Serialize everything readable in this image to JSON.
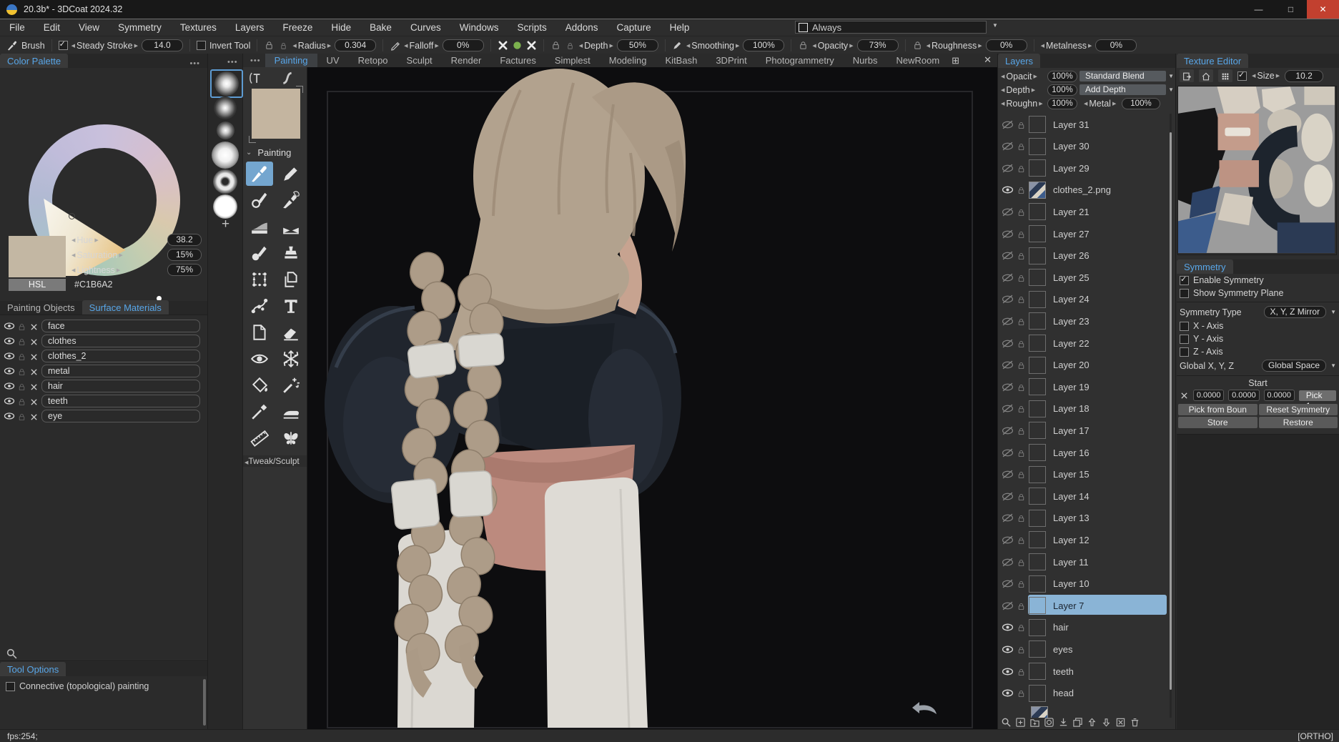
{
  "window": {
    "title": "20.3b* - 3DCoat 2024.32",
    "minimize": "—",
    "maximize": "□",
    "close": "✕"
  },
  "menubar": {
    "items": [
      "File",
      "Edit",
      "View",
      "Symmetry",
      "Textures",
      "Layers",
      "Freeze",
      "Hide",
      "Bake",
      "Curves",
      "Windows",
      "Scripts",
      "Addons",
      "Capture",
      "Help"
    ],
    "always": {
      "label": "Always",
      "checked": false
    }
  },
  "toolbar": {
    "brush": {
      "label": "Brush",
      "icon": "brush-icon"
    },
    "controls": [
      {
        "kind": "checkspin",
        "checked": true,
        "label": "Steady Stroke",
        "value": "14.0"
      },
      {
        "kind": "check",
        "checked": false,
        "label": "Invert Tool"
      },
      {
        "kind": "spin",
        "icons": [
          "lock",
          "lock2"
        ],
        "label": "Radius",
        "value": "0.304"
      },
      {
        "kind": "spin",
        "icons": [
          "pen"
        ],
        "label": "Falloff",
        "value": "0%"
      },
      {
        "kind": "iconset",
        "icons": [
          "xbold",
          "greendot",
          "xbold"
        ]
      },
      {
        "kind": "spin",
        "icons": [
          "lock",
          "lock2"
        ],
        "label": "Depth",
        "value": "50%"
      },
      {
        "kind": "spin",
        "icons": [
          "pencil"
        ],
        "label": "Smoothing",
        "value": "100%"
      },
      {
        "kind": "spin",
        "icons": [
          "lock"
        ],
        "label": "Opacity",
        "value": "73%"
      },
      {
        "kind": "spin",
        "icons": [
          "lock"
        ],
        "label": "Roughness",
        "value": "0%"
      },
      {
        "kind": "spin",
        "icons": [],
        "label": "Metalness",
        "value": "0%"
      }
    ]
  },
  "color_palette": {
    "tab": "Color Palette",
    "menu_icon": "ellipsis-menu",
    "hsl": {
      "hue_label": "Hue",
      "hue": "38.2",
      "sat_label": "Saturation",
      "sat": "15%",
      "light_label": "Lightness",
      "light": "75%",
      "mode": "HSL",
      "hex": "#C1B6A2"
    },
    "swatch": "#C1B6A2"
  },
  "object_tabs": {
    "painting_objects": "Painting Objects",
    "surface_materials": "Surface Materials",
    "active": "Surface Materials"
  },
  "materials": [
    "face",
    "clothes",
    "clothes_2",
    "metal",
    "hair",
    "teeth",
    "eye"
  ],
  "tool_options": {
    "tab": "Tool Options",
    "option": "Connective (topological) painting",
    "checked": false
  },
  "status": {
    "fps": "fps:254;",
    "mode": "[ORTHO]"
  },
  "rooms": {
    "tabs": [
      "Painting",
      "UV",
      "Retopo",
      "Sculpt",
      "Render",
      "Factures",
      "Simplest",
      "Modeling",
      "KitBash",
      "3DPrint",
      "Photogrammetry",
      "Nurbs",
      "NewRoom"
    ],
    "active": "Painting",
    "add_icon": "add-room",
    "close_icon": "close-tabbar"
  },
  "brush_panel": {
    "tips": [
      "soft-round",
      "soft-round-2",
      "small-soft",
      "large-soft",
      "ring",
      "solid"
    ],
    "selected": 0,
    "add": "+",
    "menu_icon": "ellipsis-menu"
  },
  "tool_panel": {
    "header": "Painting",
    "footer": "Tweak/Sculpt",
    "swatch": "#C4B5A0",
    "top_icons": [
      "text-frame",
      "stroke-curve"
    ],
    "tools": [
      {
        "name": "brush",
        "selected": true
      },
      {
        "name": "pencil"
      },
      {
        "name": "dry-brush"
      },
      {
        "name": "smudge"
      },
      {
        "name": "gradient"
      },
      {
        "name": "pinch"
      },
      {
        "name": "airbrush"
      },
      {
        "name": "stamp"
      },
      {
        "name": "lattice"
      },
      {
        "name": "copy"
      },
      {
        "name": "spline"
      },
      {
        "name": "text"
      },
      {
        "name": "image"
      },
      {
        "name": "eraser"
      },
      {
        "name": "eye"
      },
      {
        "name": "freeze"
      },
      {
        "name": "fill"
      },
      {
        "name": "magic-wand"
      },
      {
        "name": "picker"
      },
      {
        "name": "iron"
      },
      {
        "name": "ruler"
      },
      {
        "name": "symmetry-copy"
      }
    ]
  },
  "layers_panel": {
    "tab": "Layers",
    "opacity_label": "Opacit",
    "opacity": "100%",
    "blend": "Standard Blend",
    "depth_label": "Depth",
    "depth": "100%",
    "depth_blend": "Add Depth",
    "rough_label": "Roughn",
    "rough": "100%",
    "metal_label": "Metal",
    "metal": "100%",
    "layers": [
      {
        "name": "Layer 31",
        "visible": false
      },
      {
        "name": "Layer 30",
        "visible": false
      },
      {
        "name": "Layer 29",
        "visible": false
      },
      {
        "name": "clothes_2.png",
        "visible": true,
        "thumb": "image"
      },
      {
        "name": "Layer 21",
        "visible": false
      },
      {
        "name": "Layer 27",
        "visible": false
      },
      {
        "name": "Layer 26",
        "visible": false
      },
      {
        "name": "Layer 25",
        "visible": false
      },
      {
        "name": "Layer 24",
        "visible": false
      },
      {
        "name": "Layer 23",
        "visible": false
      },
      {
        "name": "Layer 22",
        "visible": false
      },
      {
        "name": "Layer 20",
        "visible": false
      },
      {
        "name": "Layer 19",
        "visible": false
      },
      {
        "name": "Layer 18",
        "visible": false
      },
      {
        "name": "Layer 17",
        "visible": false
      },
      {
        "name": "Layer 16",
        "visible": false
      },
      {
        "name": "Layer 15",
        "visible": false
      },
      {
        "name": "Layer 14",
        "visible": false
      },
      {
        "name": "Layer 13",
        "visible": false
      },
      {
        "name": "Layer 12",
        "visible": false
      },
      {
        "name": "Layer 11",
        "visible": false
      },
      {
        "name": "Layer 10",
        "visible": false
      },
      {
        "name": "Layer 7",
        "visible": false,
        "selected": true
      },
      {
        "name": "hair",
        "visible": true
      },
      {
        "name": "eyes",
        "visible": true
      },
      {
        "name": "teeth",
        "visible": true
      },
      {
        "name": "head",
        "visible": true
      }
    ],
    "footer_icons": [
      "search",
      "add-layer",
      "add-folder",
      "layer-mask",
      "import",
      "duplicate",
      "move-up",
      "move-down",
      "clear-layer",
      "delete"
    ]
  },
  "texture_editor": {
    "tab": "Texture Editor",
    "icons": [
      "export",
      "home",
      "grid"
    ],
    "checkbox": true,
    "size_label": "Size",
    "size": "10.2"
  },
  "symmetry": {
    "tab": "Symmetry",
    "enable": "Enable Symmetry",
    "enable_checked": true,
    "show_plane": "Show Symmetry Plane",
    "show_plane_checked": false,
    "type_label": "Symmetry Type",
    "type_value": "X, Y, Z Mirror",
    "axes": [
      "X - Axis",
      "Y - Axis",
      "Z - Axis"
    ],
    "axes_checked": [
      false,
      false,
      false
    ],
    "global_label": "Global X, Y, Z",
    "global_value": "Global Space",
    "start": "Start",
    "values": [
      "0.0000",
      "0.0000",
      "0.0000"
    ],
    "pick": "Pick 1",
    "pick_from": "Pick from Boun",
    "reset": "Reset Symmetry",
    "store": "Store",
    "restore": "Restore"
  },
  "canvas": {
    "undo_icon": "undo-arrow"
  }
}
